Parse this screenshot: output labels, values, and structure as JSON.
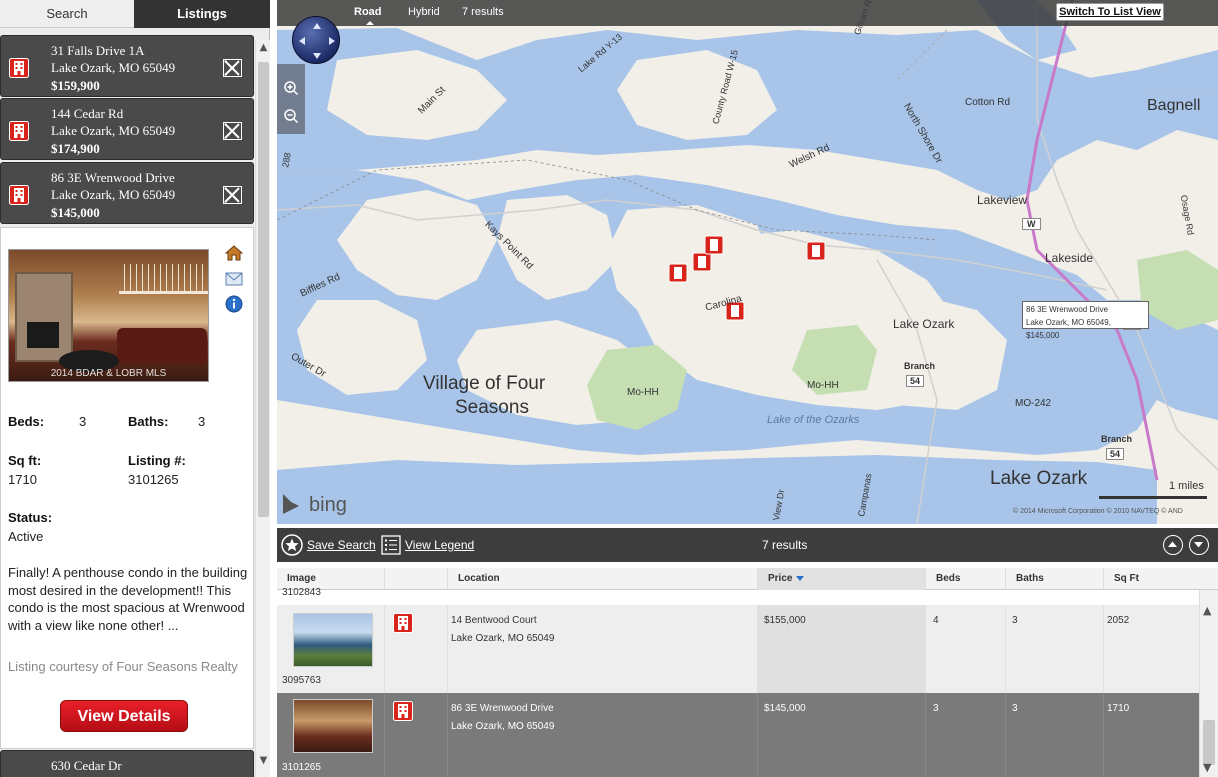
{
  "tabs": {
    "search": "Search",
    "listings": "Listings"
  },
  "listings": [
    {
      "line1": "31 Falls Drive 1A",
      "line2": "Lake Ozark, MO 65049",
      "price": "$159,900"
    },
    {
      "line1": "144 Cedar Rd",
      "line2": "Lake Ozark, MO 65049",
      "price": "$174,900"
    },
    {
      "line1": "86 3E Wrenwood Drive",
      "line2": "Lake Ozark, MO 65049",
      "price": "$145,000"
    },
    {
      "line1": "630 Cedar Dr"
    }
  ],
  "detail": {
    "watermark": "2014 BDAR & LOBR MLS",
    "beds_label": "Beds:",
    "beds": "3",
    "baths_label": "Baths:",
    "baths": "3",
    "sqft_label": "Sq ft:",
    "sqft": "1710",
    "listing_label": "Listing #:",
    "listing_no": "3101265",
    "status_label": "Status:",
    "status": "Active",
    "description": "Finally! A penthouse condo in the building most desired in the development!! This condo is the most spacious at Wrenwood with a view like none other! ...",
    "courtesy": "Listing courtesy of Four Seasons Realty",
    "view_details": "View Details"
  },
  "map": {
    "tabs": {
      "road": "Road",
      "hybrid": "Hybrid",
      "results": "7 results"
    },
    "switch_button": "Switch To List View",
    "tooltip": {
      "line1": "86 3E Wrenwood Drive",
      "line2": "Lake Ozark, MO 65049, $145,000"
    },
    "labels": {
      "bagnell": "Bagnell",
      "village1": "Village of Four",
      "village2": "Seasons",
      "lake_ozark": "Lake Ozark",
      "lake_ozark_big": "Lake Ozark",
      "lakeview": "Lakeview",
      "lakeside": "Lakeside",
      "cotton": "Cotton Rd",
      "welsh": "Welsh Rd",
      "north_shore": "North Shore Dr",
      "main": "Main St",
      "kays": "Kays Point Rd",
      "biffles": "Biffles Rd",
      "outer": "Outer Dr",
      "caroline": "Carolina",
      "mohh1": "Mo-HH",
      "mohh2": "Mo-HH",
      "mo242": "MO-242",
      "lake_of_ozarks": "Lake of the Ozarks",
      "branch1": "Branch",
      "branch2": "Branch",
      "county": "County Road W-15",
      "lakerd": "Lake Rd Y-13",
      "osage": "Osage Rd",
      "gilliam": "Gilliam Rd",
      "r288": "288",
      "w": "W",
      "s54a": "54",
      "s54b": "54",
      "s54c": "54",
      "view_dr": "View Dr",
      "campanas": "Campanas"
    },
    "scale": "1 miles",
    "bing": "bing",
    "copyright": "© 2014 Microsoft Corporation   © 2010 NAVTEQ   © AND"
  },
  "results_bar": {
    "save_search": "Save Search",
    "view_legend": "View Legend",
    "count": "7 results"
  },
  "table": {
    "headers": [
      "Image",
      "",
      "Location",
      "Price",
      "Beds",
      "Baths",
      "Sq Ft"
    ],
    "partial_id": "3102843",
    "rows": [
      {
        "location1": "14 Bentwood Court",
        "location2": "Lake Ozark, MO  65049",
        "price": "$155,000",
        "beds": "4",
        "baths": "3",
        "sqft": "2052",
        "id": "3095763"
      },
      {
        "location1": "86 3E Wrenwood Drive",
        "location2": "Lake Ozark, MO  65049",
        "price": "$145,000",
        "beds": "3",
        "baths": "3",
        "sqft": "1710",
        "id": "3101265"
      }
    ]
  },
  "colors": {
    "accent_red": "#d9241b",
    "dark_panel": "#4a4a4a",
    "water": "#a8c4e8",
    "land": "#f2efe9"
  }
}
